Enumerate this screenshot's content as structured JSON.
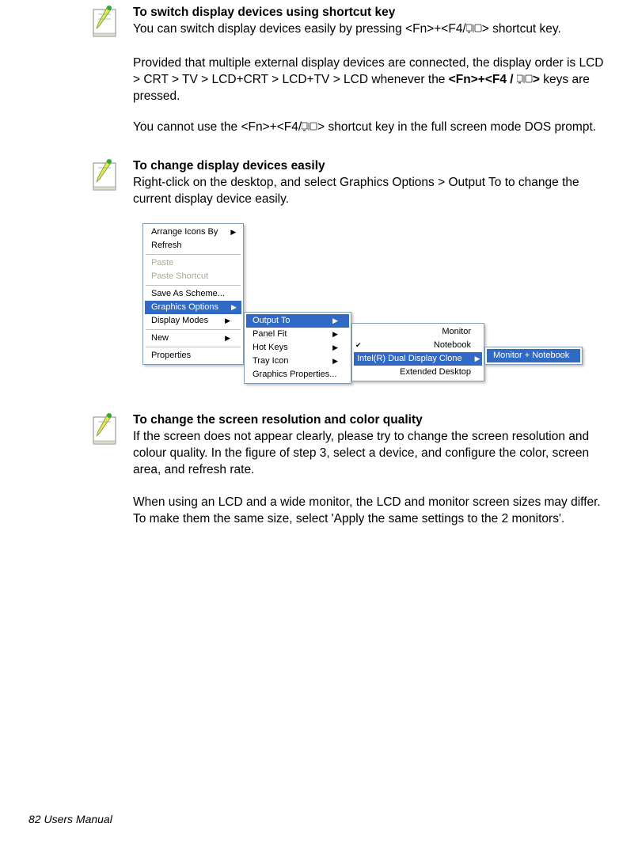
{
  "section1": {
    "title": "To switch display devices using shortcut key",
    "p1a": "You can switch display devices easily by pressing <Fn>+<F4/",
    "p1b": "> shortcut key.",
    "p2a": "Provided that multiple external display devices are connected, the display order is LCD > CRT > TV > LCD+CRT > LCD+TV > LCD whenever the ",
    "p2bold": "<Fn>+<F4 / ",
    "p2boldend": ">",
    "p2c": " keys are pressed.",
    "p3a": "You cannot use the <Fn>+<F4/",
    "p3b": "> shortcut key in the full screen mode DOS prompt."
  },
  "section2": {
    "title": "To change display devices easily",
    "p1": "Right-click on the desktop, and select Graphics Options > Output To to change the current display device easily."
  },
  "section3": {
    "title": "To change the screen resolution and color quality",
    "p1": "If the screen does not appear clearly, please try to change the screen resolution and colour quality. In the figure of step 3, select a device, and configure the color, screen area, and refresh rate.",
    "p2": "When using an LCD and a wide monitor, the LCD and monitor screen sizes may differ. To make them the same size, select 'Apply the same settings to the 2 monitors'."
  },
  "menu": {
    "m1": [
      "Arrange Icons By",
      "Refresh",
      "Paste",
      "Paste Shortcut",
      "Save As Scheme...",
      "Graphics Options",
      "Display Modes",
      "New",
      "Properties"
    ],
    "m2": [
      "Output To",
      "Panel Fit",
      "Hot Keys",
      "Tray Icon",
      "Graphics Properties..."
    ],
    "m3": [
      "Monitor",
      "Notebook",
      "Intel(R) Dual Display Clone",
      "Extended Desktop"
    ],
    "m4": [
      "Monitor + Notebook"
    ]
  },
  "footer": "82  Users Manual"
}
